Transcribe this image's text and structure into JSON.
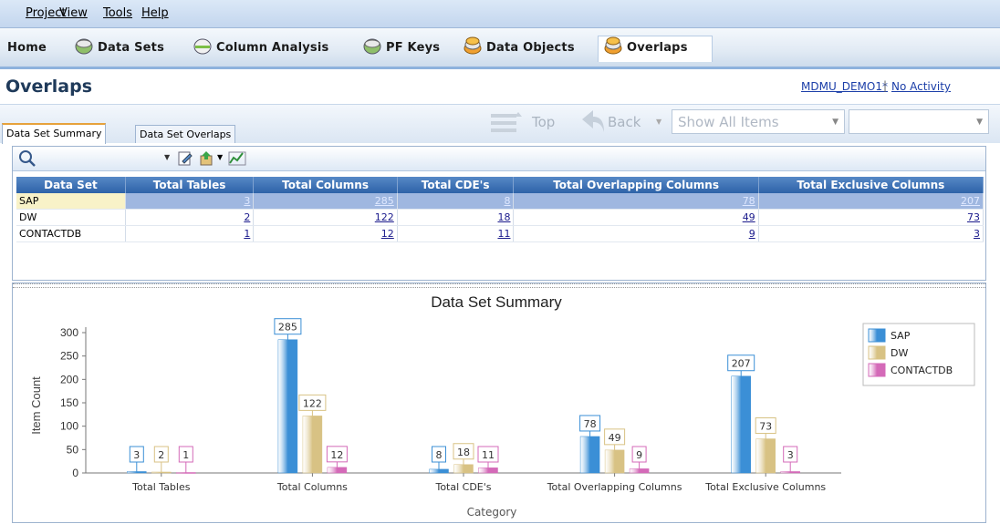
{
  "menu": [
    "Project",
    "View",
    "Tools",
    "Help"
  ],
  "nav": {
    "items": [
      {
        "label": "Home",
        "icon": "home-icon"
      },
      {
        "label": "Data Sets",
        "icon": "data-sets-icon"
      },
      {
        "label": "Column Analysis",
        "icon": "column-analysis-icon"
      },
      {
        "label": "PF Keys",
        "icon": "pf-keys-icon"
      },
      {
        "label": "Data Objects",
        "icon": "data-objects-icon"
      },
      {
        "label": "Overlaps",
        "icon": "overlaps-icon",
        "active": true
      }
    ]
  },
  "page": {
    "title": "Overlaps",
    "project": "MDMU_DEMO1*",
    "separator": "|",
    "activity": "No Activity"
  },
  "tabs": [
    {
      "label": "Data Set Summary",
      "active": true
    },
    {
      "label": "Data Set Overlaps",
      "active": false
    }
  ],
  "toolbar": {
    "top_label": "Top",
    "back_label": "Back",
    "filter_value": "Show All Items",
    "second_value": ""
  },
  "grid": {
    "columns": [
      "Data Set",
      "Total Tables",
      "Total Columns",
      "Total CDE's",
      "Total Overlapping Columns",
      "Total Exclusive Columns"
    ],
    "rows": [
      {
        "name": "SAP",
        "values": [
          "3",
          "285",
          "8",
          "78",
          "207"
        ],
        "selected": true
      },
      {
        "name": "DW",
        "values": [
          "2",
          "122",
          "18",
          "49",
          "73"
        ],
        "selected": false
      },
      {
        "name": "CONTACTDB",
        "values": [
          "1",
          "12",
          "11",
          "9",
          "3"
        ],
        "selected": false
      }
    ]
  },
  "chart_data": {
    "type": "bar",
    "title": "Data Set Summary",
    "xlabel": "Category",
    "ylabel": "Item Count",
    "categories": [
      "Total Tables",
      "Total Columns",
      "Total CDE's",
      "Total Overlapping Columns",
      "Total Exclusive Columns"
    ],
    "series": [
      {
        "name": "SAP",
        "values": [
          3,
          285,
          8,
          78,
          207
        ],
        "color": "#3b8fd6"
      },
      {
        "name": "DW",
        "values": [
          2,
          122,
          18,
          49,
          73
        ],
        "color": "#d8c284"
      },
      {
        "name": "CONTACTDB",
        "values": [
          1,
          12,
          11,
          9,
          3
        ],
        "color": "#d46ab8"
      }
    ],
    "ylim": [
      0,
      300
    ],
    "yticks": [
      "0",
      "50",
      "100",
      "150",
      "200",
      "250",
      "300"
    ],
    "legend": "right",
    "grid": false,
    "data_labels": true
  },
  "colors": {
    "header_blue": "#2e63a8",
    "selected_row": "#9fb7e0",
    "link": "#1b3ea8"
  }
}
